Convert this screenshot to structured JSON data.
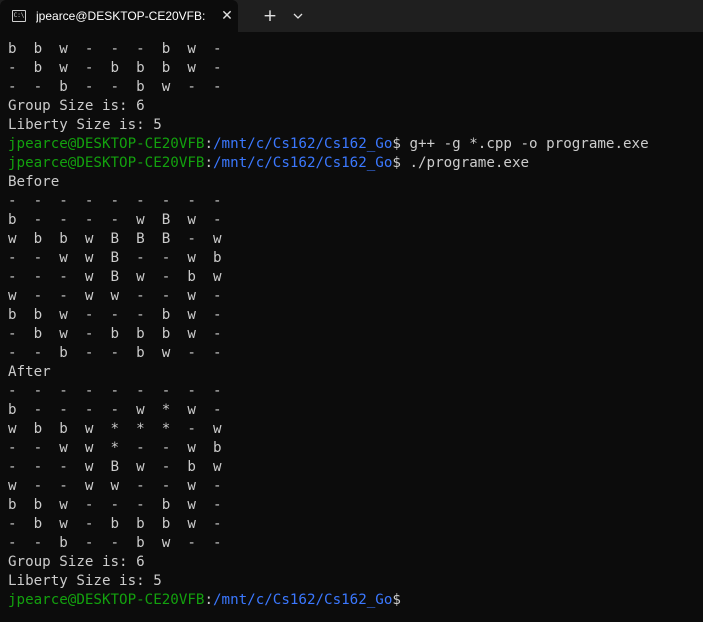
{
  "tab": {
    "icon": "terminal-icon",
    "icon_text": "C:\\",
    "title": "jpearce@DESKTOP-CE20VFB: /",
    "close": "✕",
    "new_tab": "+",
    "dropdown": "chevron-down-icon"
  },
  "colors": {
    "background": "#0c0c0c",
    "titlebar": "#1f1f1f",
    "text": "#cccccc",
    "prompt_user": "#13a10e",
    "prompt_path": "#3b78ff"
  },
  "console": {
    "lines": [
      {
        "type": "text",
        "text": "b  b  w  -  -  -  b  w  -"
      },
      {
        "type": "text",
        "text": "-  b  w  -  b  b  b  w  -"
      },
      {
        "type": "text",
        "text": "-  -  b  -  -  b  w  -  -"
      },
      {
        "type": "text",
        "text": "Group Size is: 6"
      },
      {
        "type": "text",
        "text": "Liberty Size is: 5"
      },
      {
        "type": "prompt",
        "user": "jpearce@DESKTOP-CE20VFB",
        "path": "/mnt/c/Cs162/Cs162_Go",
        "cmd": "$ g++ -g *.cpp -o programe.exe"
      },
      {
        "type": "prompt",
        "user": "jpearce@DESKTOP-CE20VFB",
        "path": "/mnt/c/Cs162/Cs162_Go",
        "cmd": "$ ./programe.exe"
      },
      {
        "type": "text",
        "text": "Before"
      },
      {
        "type": "text",
        "text": "-  -  -  -  -  -  -  -  -"
      },
      {
        "type": "text",
        "text": "b  -  -  -  -  w  B  w  -"
      },
      {
        "type": "text",
        "text": "w  b  b  w  B  B  B  -  w"
      },
      {
        "type": "text",
        "text": "-  -  w  w  B  -  -  w  b"
      },
      {
        "type": "text",
        "text": "-  -  -  w  B  w  -  b  w"
      },
      {
        "type": "text",
        "text": "w  -  -  w  w  -  -  w  -"
      },
      {
        "type": "text",
        "text": "b  b  w  -  -  -  b  w  -"
      },
      {
        "type": "text",
        "text": "-  b  w  -  b  b  b  w  -"
      },
      {
        "type": "text",
        "text": "-  -  b  -  -  b  w  -  -"
      },
      {
        "type": "text",
        "text": "After"
      },
      {
        "type": "text",
        "text": "-  -  -  -  -  -  -  -  -"
      },
      {
        "type": "text",
        "text": "b  -  -  -  -  w  *  w  -"
      },
      {
        "type": "text",
        "text": "w  b  b  w  *  *  *  -  w"
      },
      {
        "type": "text",
        "text": "-  -  w  w  *  -  -  w  b"
      },
      {
        "type": "text",
        "text": "-  -  -  w  B  w  -  b  w"
      },
      {
        "type": "text",
        "text": "w  -  -  w  w  -  -  w  -"
      },
      {
        "type": "text",
        "text": "b  b  w  -  -  -  b  w  -"
      },
      {
        "type": "text",
        "text": "-  b  w  -  b  b  b  w  -"
      },
      {
        "type": "text",
        "text": "-  -  b  -  -  b  w  -  -"
      },
      {
        "type": "text",
        "text": "Group Size is: 6"
      },
      {
        "type": "text",
        "text": "Liberty Size is: 5"
      },
      {
        "type": "prompt",
        "user": "jpearce@DESKTOP-CE20VFB",
        "path": "/mnt/c/Cs162/Cs162_Go",
        "cmd": "$"
      }
    ]
  }
}
